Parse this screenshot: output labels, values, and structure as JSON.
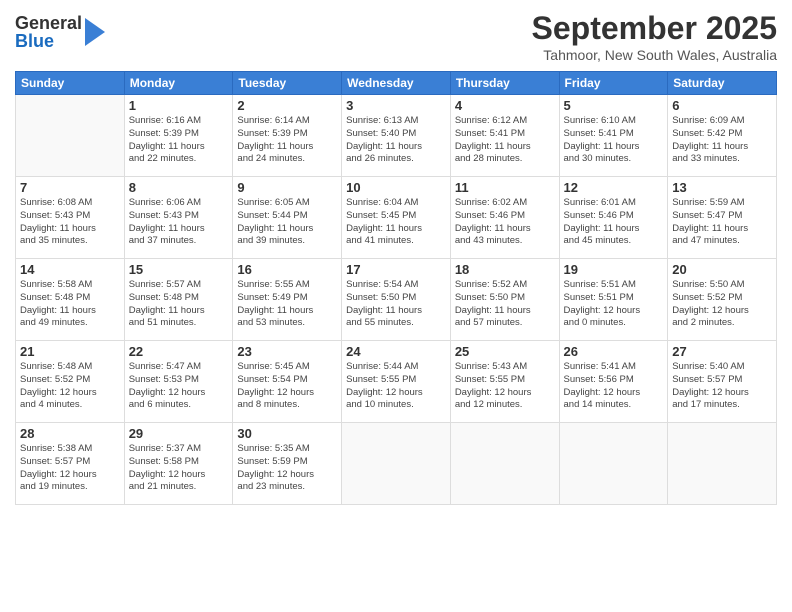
{
  "header": {
    "logo_general": "General",
    "logo_blue": "Blue",
    "month_title": "September 2025",
    "location": "Tahmoor, New South Wales, Australia"
  },
  "weekdays": [
    "Sunday",
    "Monday",
    "Tuesday",
    "Wednesday",
    "Thursday",
    "Friday",
    "Saturday"
  ],
  "weeks": [
    [
      {
        "day": "",
        "info": ""
      },
      {
        "day": "1",
        "info": "Sunrise: 6:16 AM\nSunset: 5:39 PM\nDaylight: 11 hours\nand 22 minutes."
      },
      {
        "day": "2",
        "info": "Sunrise: 6:14 AM\nSunset: 5:39 PM\nDaylight: 11 hours\nand 24 minutes."
      },
      {
        "day": "3",
        "info": "Sunrise: 6:13 AM\nSunset: 5:40 PM\nDaylight: 11 hours\nand 26 minutes."
      },
      {
        "day": "4",
        "info": "Sunrise: 6:12 AM\nSunset: 5:41 PM\nDaylight: 11 hours\nand 28 minutes."
      },
      {
        "day": "5",
        "info": "Sunrise: 6:10 AM\nSunset: 5:41 PM\nDaylight: 11 hours\nand 30 minutes."
      },
      {
        "day": "6",
        "info": "Sunrise: 6:09 AM\nSunset: 5:42 PM\nDaylight: 11 hours\nand 33 minutes."
      }
    ],
    [
      {
        "day": "7",
        "info": "Sunrise: 6:08 AM\nSunset: 5:43 PM\nDaylight: 11 hours\nand 35 minutes."
      },
      {
        "day": "8",
        "info": "Sunrise: 6:06 AM\nSunset: 5:43 PM\nDaylight: 11 hours\nand 37 minutes."
      },
      {
        "day": "9",
        "info": "Sunrise: 6:05 AM\nSunset: 5:44 PM\nDaylight: 11 hours\nand 39 minutes."
      },
      {
        "day": "10",
        "info": "Sunrise: 6:04 AM\nSunset: 5:45 PM\nDaylight: 11 hours\nand 41 minutes."
      },
      {
        "day": "11",
        "info": "Sunrise: 6:02 AM\nSunset: 5:46 PM\nDaylight: 11 hours\nand 43 minutes."
      },
      {
        "day": "12",
        "info": "Sunrise: 6:01 AM\nSunset: 5:46 PM\nDaylight: 11 hours\nand 45 minutes."
      },
      {
        "day": "13",
        "info": "Sunrise: 5:59 AM\nSunset: 5:47 PM\nDaylight: 11 hours\nand 47 minutes."
      }
    ],
    [
      {
        "day": "14",
        "info": "Sunrise: 5:58 AM\nSunset: 5:48 PM\nDaylight: 11 hours\nand 49 minutes."
      },
      {
        "day": "15",
        "info": "Sunrise: 5:57 AM\nSunset: 5:48 PM\nDaylight: 11 hours\nand 51 minutes."
      },
      {
        "day": "16",
        "info": "Sunrise: 5:55 AM\nSunset: 5:49 PM\nDaylight: 11 hours\nand 53 minutes."
      },
      {
        "day": "17",
        "info": "Sunrise: 5:54 AM\nSunset: 5:50 PM\nDaylight: 11 hours\nand 55 minutes."
      },
      {
        "day": "18",
        "info": "Sunrise: 5:52 AM\nSunset: 5:50 PM\nDaylight: 11 hours\nand 57 minutes."
      },
      {
        "day": "19",
        "info": "Sunrise: 5:51 AM\nSunset: 5:51 PM\nDaylight: 12 hours\nand 0 minutes."
      },
      {
        "day": "20",
        "info": "Sunrise: 5:50 AM\nSunset: 5:52 PM\nDaylight: 12 hours\nand 2 minutes."
      }
    ],
    [
      {
        "day": "21",
        "info": "Sunrise: 5:48 AM\nSunset: 5:52 PM\nDaylight: 12 hours\nand 4 minutes."
      },
      {
        "day": "22",
        "info": "Sunrise: 5:47 AM\nSunset: 5:53 PM\nDaylight: 12 hours\nand 6 minutes."
      },
      {
        "day": "23",
        "info": "Sunrise: 5:45 AM\nSunset: 5:54 PM\nDaylight: 12 hours\nand 8 minutes."
      },
      {
        "day": "24",
        "info": "Sunrise: 5:44 AM\nSunset: 5:55 PM\nDaylight: 12 hours\nand 10 minutes."
      },
      {
        "day": "25",
        "info": "Sunrise: 5:43 AM\nSunset: 5:55 PM\nDaylight: 12 hours\nand 12 minutes."
      },
      {
        "day": "26",
        "info": "Sunrise: 5:41 AM\nSunset: 5:56 PM\nDaylight: 12 hours\nand 14 minutes."
      },
      {
        "day": "27",
        "info": "Sunrise: 5:40 AM\nSunset: 5:57 PM\nDaylight: 12 hours\nand 17 minutes."
      }
    ],
    [
      {
        "day": "28",
        "info": "Sunrise: 5:38 AM\nSunset: 5:57 PM\nDaylight: 12 hours\nand 19 minutes."
      },
      {
        "day": "29",
        "info": "Sunrise: 5:37 AM\nSunset: 5:58 PM\nDaylight: 12 hours\nand 21 minutes."
      },
      {
        "day": "30",
        "info": "Sunrise: 5:35 AM\nSunset: 5:59 PM\nDaylight: 12 hours\nand 23 minutes."
      },
      {
        "day": "",
        "info": ""
      },
      {
        "day": "",
        "info": ""
      },
      {
        "day": "",
        "info": ""
      },
      {
        "day": "",
        "info": ""
      }
    ]
  ]
}
